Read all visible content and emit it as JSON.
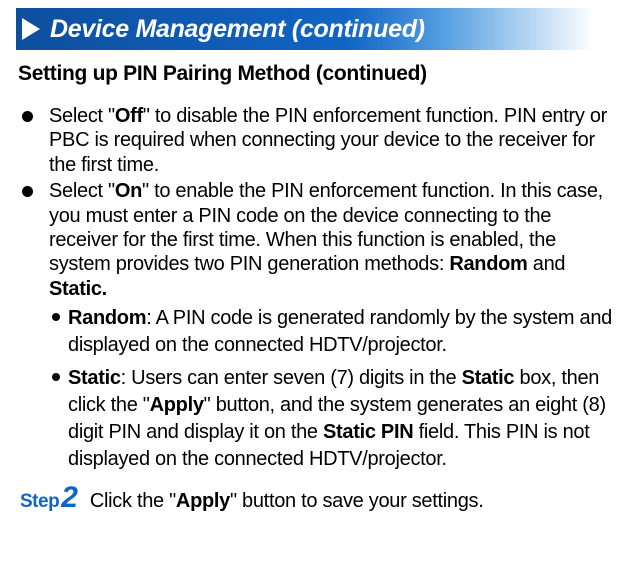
{
  "header": {
    "title": "Device Management (continued)"
  },
  "subheading": "Setting up PIN Pairing Method (continued)",
  "bullets": [
    {
      "pre": "Select \"",
      "bold1": "Off",
      "post": "\" to disable the PIN enforcement function. PIN entry or PBC is required when connecting your device to the receiver for the first time."
    },
    {
      "pre": "Select \"",
      "bold1": "On",
      "post_a": "\" to enable the PIN enforcement function. In this case, you must enter a PIN code on the device connecting to the receiver for the first time. When this function is en­abled, the system provides two PIN generation methods: ",
      "bold2": "Random",
      "mid": " and ",
      "bold3": "Static."
    }
  ],
  "sub_bullets": [
    {
      "bold1": "Random",
      "post": ": A PIN code is generated randomly by the sys­tem and displayed on the connected HDTV/projector."
    },
    {
      "bold1": "Static",
      "post_a": ": Users can enter seven (7) digits in the ",
      "bold2": "Static",
      "post_b": " box, then click the \"",
      "bold3": "Apply",
      "post_c": "\" button, and the system generates an eight (8) digit PIN and display it on the ",
      "bold4": "Static PIN",
      "post_d": " field. This PIN is not displayed on the connected HDTV/projector."
    }
  ],
  "step": {
    "label": "Step",
    "number": "2",
    "pre": "Click the \"",
    "bold": "Apply",
    "post": "\" button to save your settings."
  }
}
